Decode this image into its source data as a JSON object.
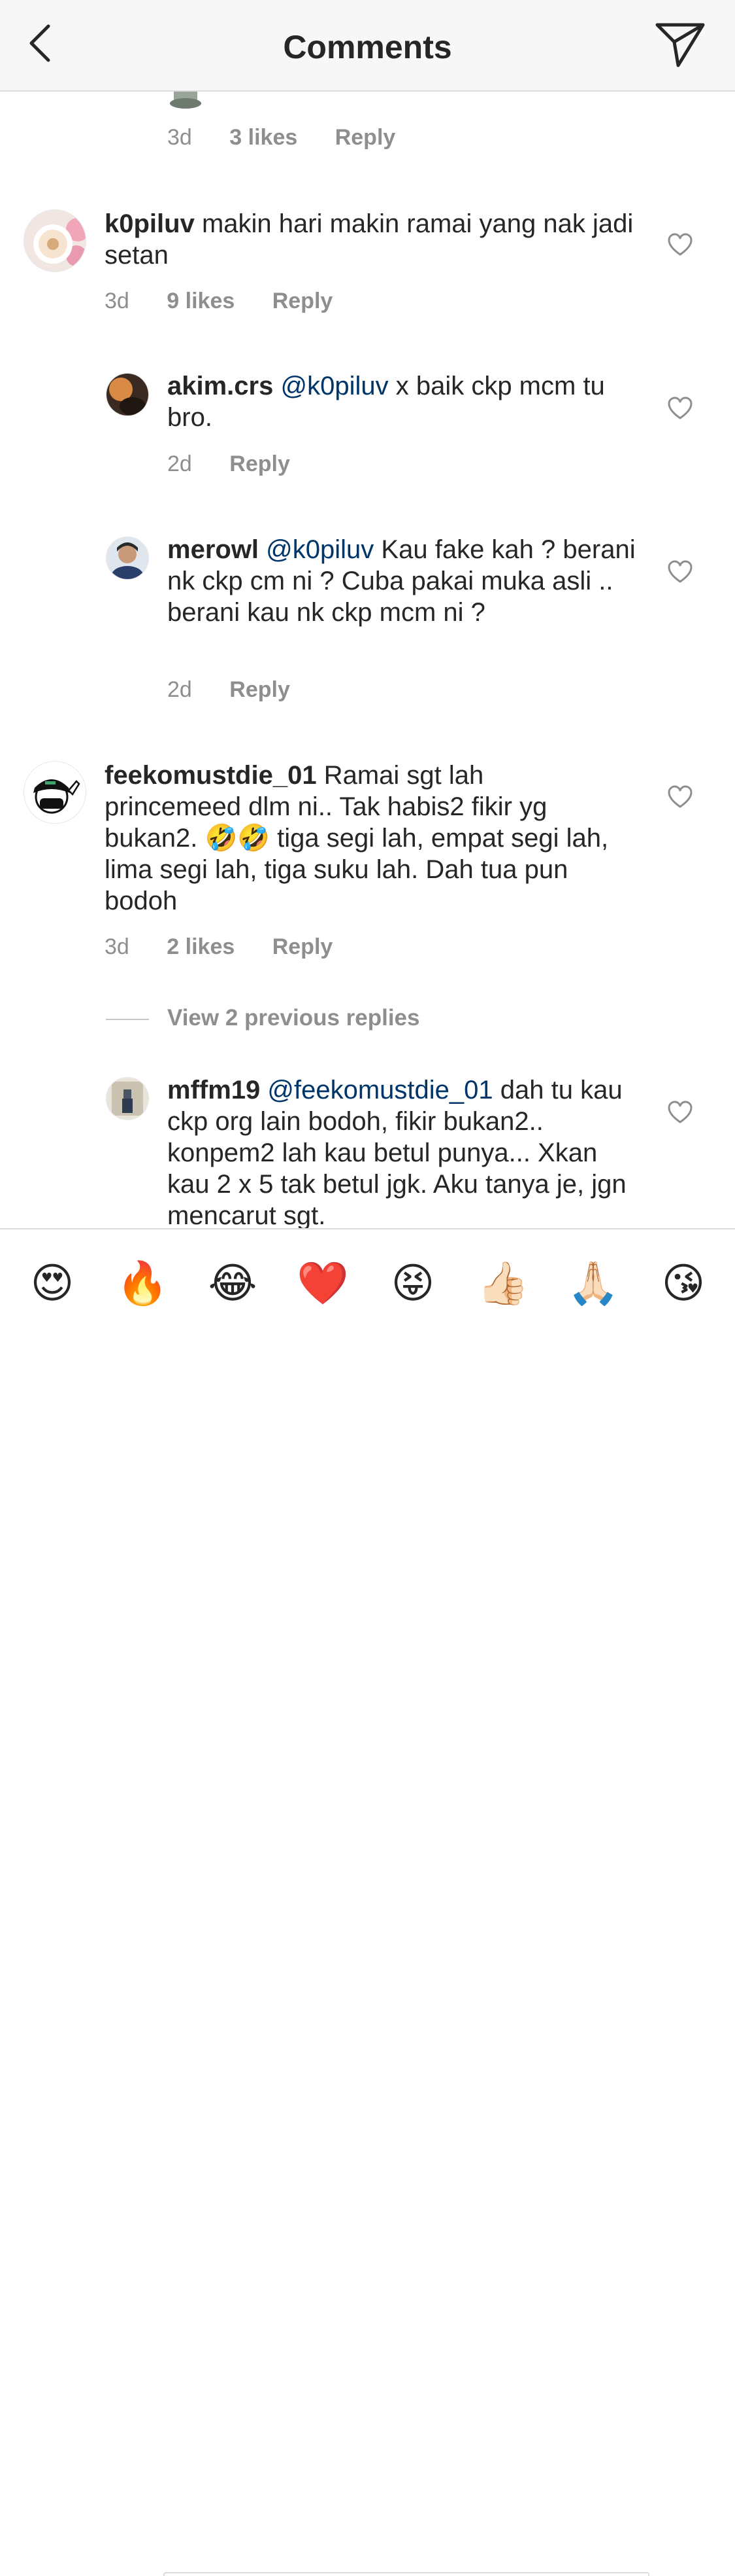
{
  "header": {
    "title": "Comments"
  },
  "partial_comment": {
    "time": "3d",
    "likes": "3 likes",
    "reply": "Reply"
  },
  "comments": [
    {
      "username": "k0piluv",
      "text": "makin hari makin ramai yang nak jadi setan",
      "time": "3d",
      "likes": "9 likes",
      "reply": "Reply"
    },
    {
      "username": "akim.crs",
      "mention": "@k0piluv",
      "text": "x baik ckp mcm tu bro.",
      "time": "2d",
      "reply": "Reply"
    },
    {
      "username": "merowl",
      "mention": "@k0piluv",
      "text": "Kau fake kah ? berani nk ckp cm ni ? Cuba pakai muka asli .. berani kau nk ckp mcm ni ?",
      "time": "2d",
      "reply": "Reply"
    },
    {
      "username": "feekomustdie_01",
      "text": "Ramai sgt lah princemeed dlm ni.. Tak habis2 fikir yg bukan2. 🤣🤣 tiga segi lah, empat segi lah, lima segi lah, tiga suku lah. Dah tua pun bodoh",
      "time": "3d",
      "likes": "2 likes",
      "reply": "Reply"
    },
    {
      "username": "mffm19",
      "mention": "@feekomustdie_01",
      "text": "dah tu kau ckp org lain bodoh, fikir bukan2.. konpem2 lah kau betul punya... Xkan kau 2 x 5 tak betul jgk. Aku tanya je, jgn mencarut sgt."
    }
  ],
  "view_previous": "View 2 previous replies",
  "emoji_bar": [
    "😍",
    "🔥",
    "😂",
    "❤️",
    "😝",
    "👍🏻",
    "🙏🏻",
    "😘"
  ]
}
